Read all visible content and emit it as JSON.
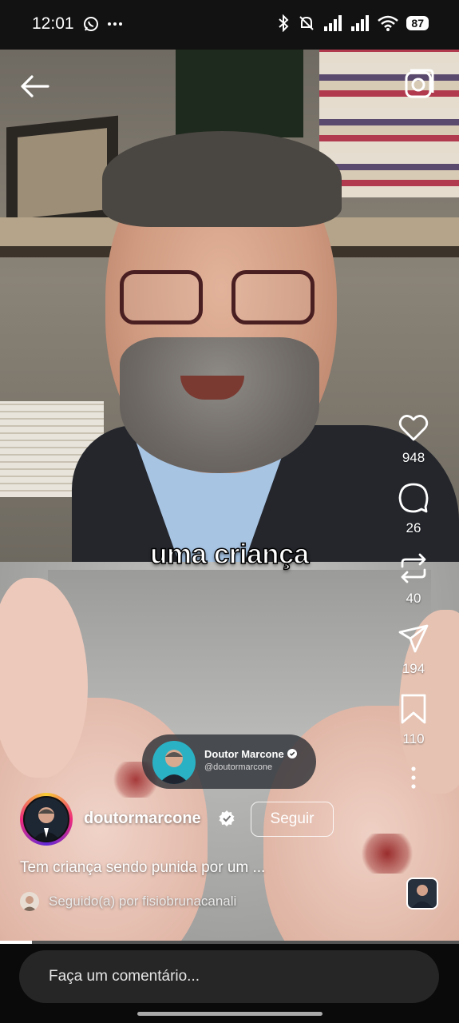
{
  "status_bar": {
    "time": "12:01",
    "left_icons": [
      "whatsapp-icon",
      "more-dots-icon"
    ],
    "right_icons": [
      "bluetooth-icon",
      "bell-off-icon",
      "signal-icon",
      "signal-icon",
      "wifi-icon"
    ],
    "battery": "87"
  },
  "video": {
    "caption": "uma criança",
    "progress_fraction": 0.07,
    "watermark": {
      "name": "Doutor Marcone",
      "handle": "@doutormarcone"
    }
  },
  "actions": {
    "like_count": "948",
    "comment_count": "26",
    "repost_count": "40",
    "share_count": "194",
    "save_count": "110"
  },
  "author": {
    "username": "doutormarcone",
    "follow_label": "Seguir",
    "description": "Tem criança sendo punida por um ...",
    "followed_by": "Seguido(a) por fisiobrunacanali"
  },
  "comment": {
    "placeholder": "Faça um comentário..."
  },
  "colors": {
    "background": "#000000",
    "verified": "#ffffff",
    "comment_box": "#262626"
  }
}
